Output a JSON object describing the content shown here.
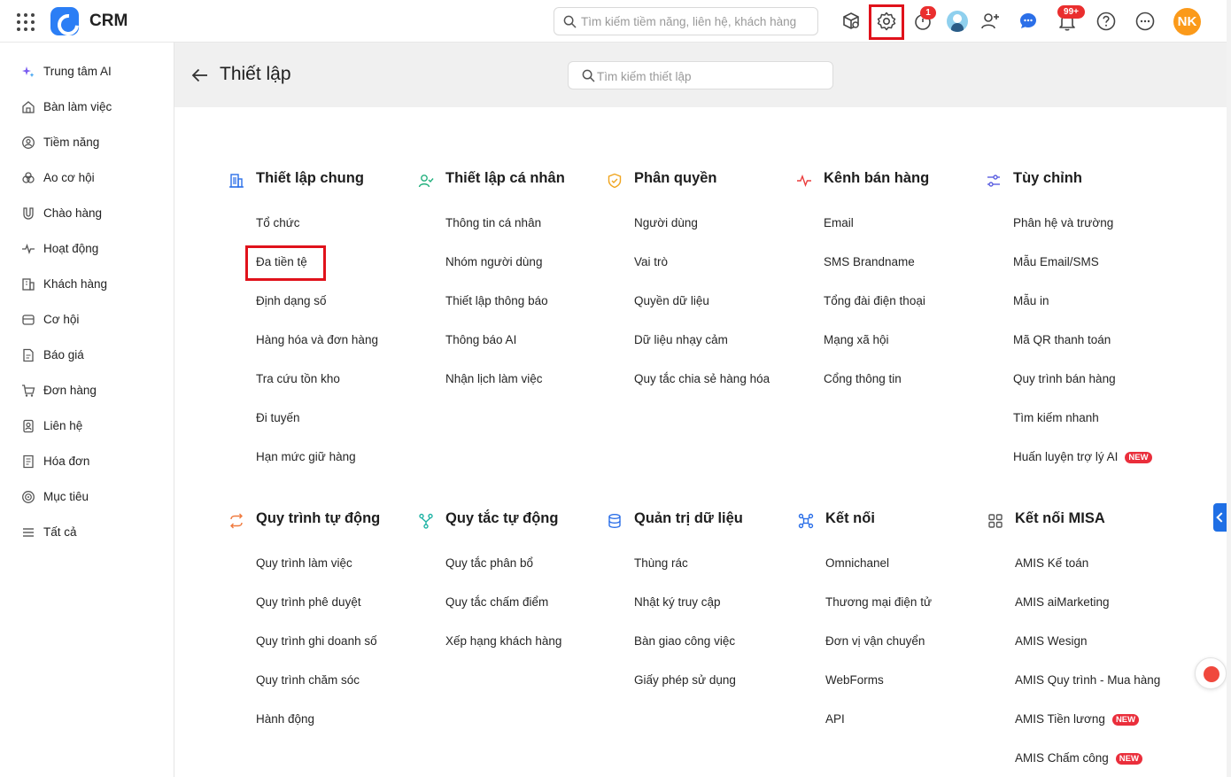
{
  "header": {
    "brand": "CRM",
    "search_placeholder": "Tìm kiếm tiềm năng, liên hệ, khách hàng",
    "timer_badge": "1",
    "notification_badge": "99+",
    "user_initials": "NK",
    "accent_color": "#2b7ef5"
  },
  "sidebar": {
    "items": [
      {
        "label": "Trung tâm AI",
        "icon": "sparkle-icon"
      },
      {
        "label": "Bàn làm việc",
        "icon": "home-icon"
      },
      {
        "label": "Tiềm năng",
        "icon": "target-user-icon"
      },
      {
        "label": "Ao cơ hội",
        "icon": "pool-icon"
      },
      {
        "label": "Chào hàng",
        "icon": "magnet-icon"
      },
      {
        "label": "Hoạt động",
        "icon": "pulse-icon"
      },
      {
        "label": "Khách hàng",
        "icon": "building-icon"
      },
      {
        "label": "Cơ hội",
        "icon": "opportunity-icon"
      },
      {
        "label": "Báo giá",
        "icon": "quote-icon"
      },
      {
        "label": "Đơn hàng",
        "icon": "cart-icon"
      },
      {
        "label": "Liên hệ",
        "icon": "contact-icon"
      },
      {
        "label": "Hóa đơn",
        "icon": "invoice-icon"
      },
      {
        "label": "Mục tiêu",
        "icon": "goal-icon"
      },
      {
        "label": "Tất cả",
        "icon": "menu-icon"
      }
    ]
  },
  "main": {
    "title": "Thiết lập",
    "search_placeholder": "Tìm kiếm thiết lập",
    "sections": [
      {
        "title": "Thiết lập chung",
        "items": [
          "Tổ chức",
          "Đa tiền tệ",
          "Định dạng số",
          "Hàng hóa và đơn hàng",
          "Tra cứu tồn kho",
          "Đi tuyến",
          "Hạn mức giữ hàng"
        ]
      },
      {
        "title": "Thiết lập cá nhân",
        "items": [
          "Thông tin cá nhân",
          "Nhóm người dùng",
          "Thiết lập thông báo",
          "Thông báo AI",
          "Nhận lịch làm việc"
        ]
      },
      {
        "title": "Phân quyền",
        "items": [
          "Người dùng",
          "Vai trò",
          "Quyền dữ liệu",
          "Dữ liệu nhạy cảm",
          "Quy tắc chia sẻ hàng hóa"
        ]
      },
      {
        "title": "Kênh bán hàng",
        "items": [
          "Email",
          "SMS Brandname",
          "Tổng đài điện thoại",
          "Mạng xã hội",
          "Cổng thông tin"
        ]
      },
      {
        "title": "Tùy chỉnh",
        "items": [
          "Phân hệ và trường",
          "Mẫu Email/SMS",
          "Mẫu in",
          "Mã QR thanh toán",
          "Quy trình bán hàng",
          "Tìm kiếm nhanh",
          "Huấn luyện trợ lý AI"
        ]
      },
      {
        "title": "Quy trình tự động",
        "items": [
          "Quy trình làm việc",
          "Quy trình phê duyệt",
          "Quy trình ghi doanh số",
          "Quy trình chăm sóc",
          "Hành động"
        ]
      },
      {
        "title": "Quy tắc tự động",
        "items": [
          "Quy tắc phân bổ",
          "Quy tắc chấm điểm",
          "Xếp hạng khách hàng"
        ]
      },
      {
        "title": "Quản trị dữ liệu",
        "items": [
          "Thùng rác",
          "Nhật ký truy cập",
          "Bàn giao công việc",
          "Giấy phép sử dụng"
        ]
      },
      {
        "title": "Kết nối",
        "items": [
          "Omnichanel",
          "Thương mại điện tử",
          "Đơn vị vận chuyển",
          "WebForms",
          "API"
        ]
      },
      {
        "title": "Kết nối MISA",
        "items": [
          "AMIS Kế toán",
          "AMIS aiMarketing",
          "AMIS Wesign",
          "AMIS Quy trình - Mua hàng",
          "AMIS Tiền lương",
          "AMIS Chấm công"
        ]
      }
    ],
    "new_tag": "NEW"
  }
}
